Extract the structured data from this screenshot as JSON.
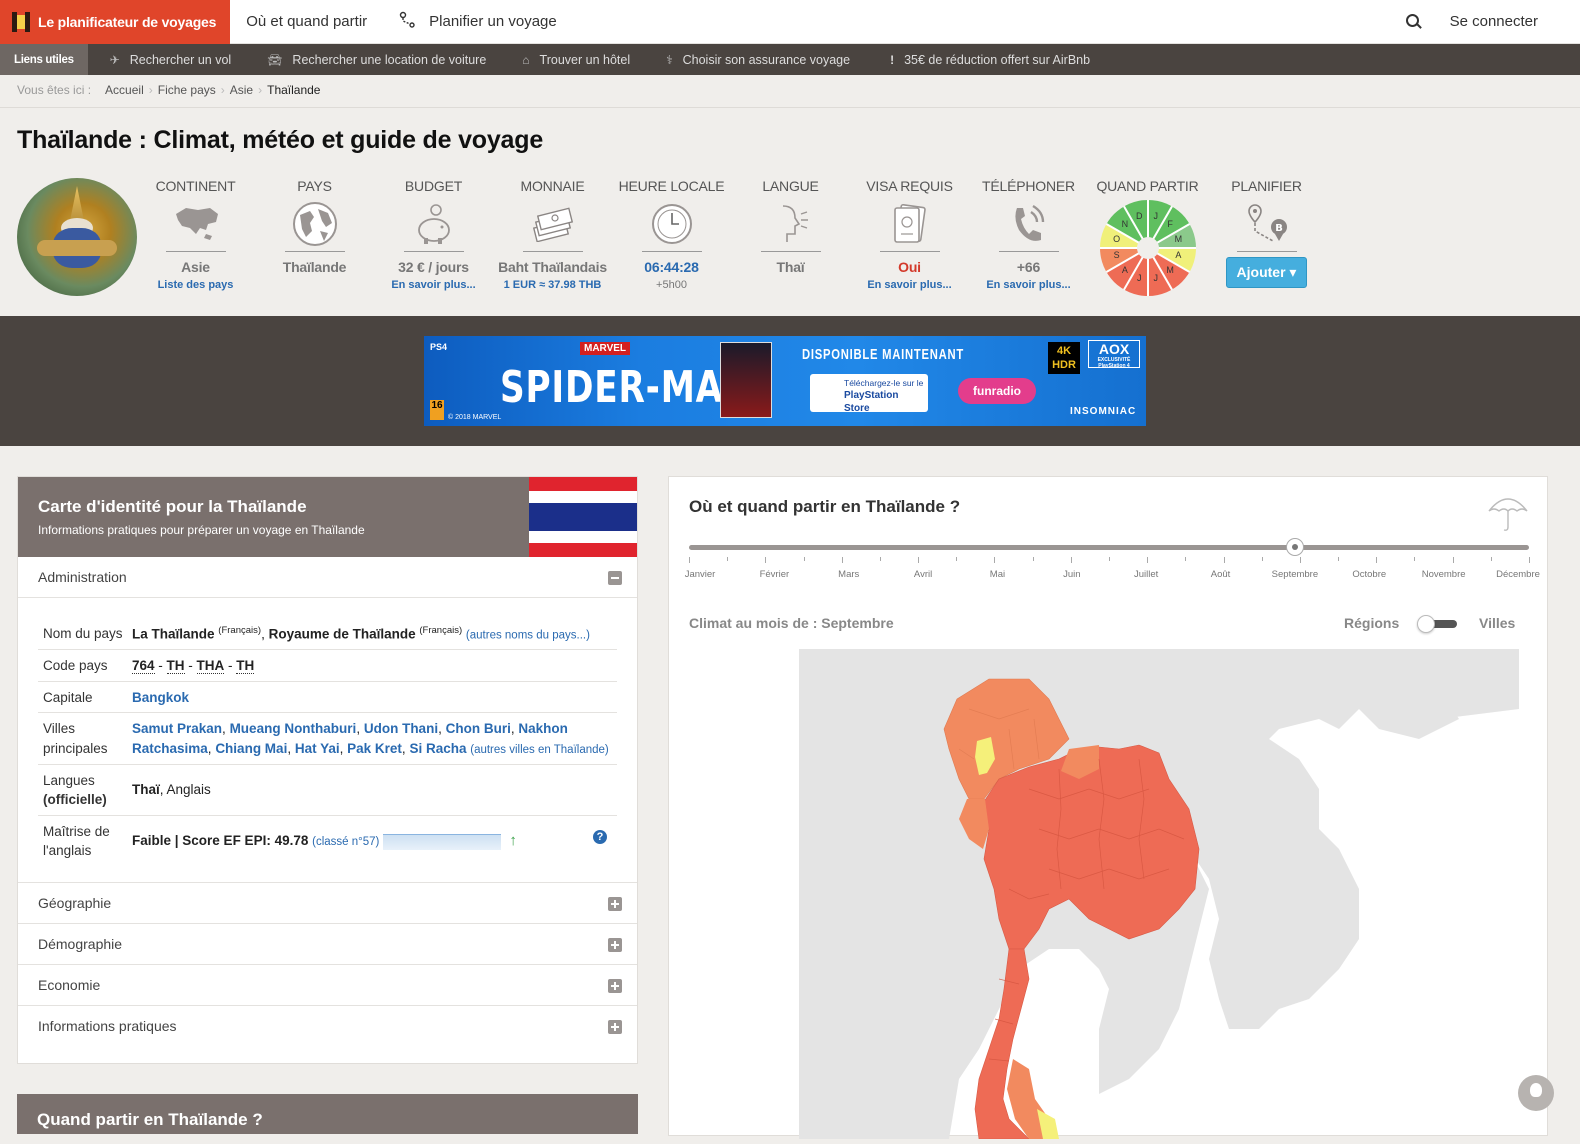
{
  "nav": {
    "brand": "Le planificateur de voyages",
    "where_when": "Où et quand partir",
    "plan_trip": "Planifier un voyage",
    "login": "Se connecter"
  },
  "links": {
    "label": "Liens utiles",
    "items": [
      {
        "icon": "plane-icon",
        "label": "Rechercher un vol"
      },
      {
        "icon": "car-icon",
        "label": "Rechercher une location de voiture"
      },
      {
        "icon": "bed-icon",
        "label": "Trouver un hôtel"
      },
      {
        "icon": "stethoscope-icon",
        "label": "Choisir son assurance voyage"
      },
      {
        "icon": "exclamation-icon",
        "label": "35€ de réduction offert sur AirBnb"
      }
    ]
  },
  "breadcrumb": {
    "prefix": "Vous êtes ici :",
    "items": [
      "Accueil",
      "Fiche pays",
      "Asie"
    ],
    "current": "Thaïlande"
  },
  "page_title": "Thaïlande : Climat, météo et guide de voyage",
  "facts": [
    {
      "head": "CONTINENT",
      "icon": "asia-map-icon",
      "value": "Asie",
      "sub": "Liste des pays"
    },
    {
      "head": "PAYS",
      "icon": "globe-icon",
      "value": "Thaïlande",
      "sub": ""
    },
    {
      "head": "BUDGET",
      "icon": "piggy-bank-icon",
      "value": "32 € / jours",
      "sub": "En savoir plus..."
    },
    {
      "head": "MONNAIE",
      "icon": "banknotes-icon",
      "value": "Baht Thaïlandais",
      "sub": "1 EUR ≈ 37.98 THB"
    },
    {
      "head": "HEURE LOCALE",
      "icon": "clock-icon",
      "value": "06:44:28",
      "sub": "+5h00"
    },
    {
      "head": "LANGUE",
      "icon": "speaking-head-icon",
      "value": "Thaï",
      "sub": ""
    },
    {
      "head": "VISA REQUIS",
      "icon": "passport-icon",
      "value": "Oui",
      "sub": "En savoir plus..."
    },
    {
      "head": "TÉLÉPHONER",
      "icon": "phone-icon",
      "value": "+66",
      "sub": "En savoir plus..."
    },
    {
      "head": "QUAND PARTIR",
      "icon": "month-wheel-icon"
    },
    {
      "head": "PLANIFIER",
      "icon": "route-pin-icon",
      "button": "Ajouter ▾"
    }
  ],
  "month_wheel": [
    "J",
    "F",
    "M",
    "A",
    "M",
    "J",
    "J",
    "A",
    "S",
    "O",
    "N",
    "D"
  ],
  "month_wheel_colors": [
    "#5fbf5f",
    "#5fbf5f",
    "#8bc98b",
    "#f0f07a",
    "#ee6b55",
    "#ee6b55",
    "#ee6b55",
    "#ee6b55",
    "#f28a5f",
    "#f0f07a",
    "#5fbf5f",
    "#5fbf5f"
  ],
  "ad": {
    "ps4": "PS4",
    "marvel": "MARVEL",
    "title": "SPIDER-MAN",
    "available": "DISPONIBLE MAINTENANT",
    "store_line1": "Téléchargez-le sur le",
    "store_line2": "PlayStation Store",
    "radio": "funradio",
    "hdr": "4K HDR",
    "aox": "AOX",
    "aox_sub": "EXCLUSIVITÉ PlayStation 4",
    "studio": "INSOMNIAC",
    "pegi": "16",
    "copyright": "© 2018 MARVEL"
  },
  "identity": {
    "title": "Carte d'identité pour la Thaïlande",
    "subtitle": "Informations pratiques pour préparer un voyage en Thaïlande",
    "flag_colors": [
      "#e0242e",
      "#ffffff",
      "#1b2f8a",
      "#ffffff",
      "#e0242e"
    ],
    "open_section": "Administration",
    "rows": {
      "name_key": "Nom du pays",
      "name_v1": "La Thaïlande",
      "name_lang1": "(Français)",
      "name_v2": "Royaume de Thaïlande",
      "name_lang2": "(Français)",
      "name_more": "(autres noms du pays...)",
      "code_key": "Code pays",
      "code_v1": "764",
      "code_v2": "TH",
      "code_v3": "THA",
      "code_v4": "TH",
      "capital_key": "Capitale",
      "capital": "Bangkok",
      "cities_key": "Villes principales",
      "cities": [
        "Samut Prakan",
        "Mueang Nonthaburi",
        "Udon Thani",
        "Chon Buri",
        "Nakhon Ratchasima",
        "Chiang Mai",
        "Hat Yai",
        "Pak Kret",
        "Si Racha"
      ],
      "cities_more": "(autres villes en Thaïlande)",
      "lang_key1": "Langues",
      "lang_key2": "(officielle)",
      "lang_v1": "Thaï",
      "lang_v2": ", Anglais",
      "eng_key": "Maîtrise de l'anglais",
      "eng_value": "Faible | Score EF EPI: 49.78",
      "eng_rank": "(classé n°57)",
      "eng_trend": "↑",
      "help": "?"
    },
    "sections": [
      "Géographie",
      "Démographie",
      "Economie",
      "Informations pratiques"
    ]
  },
  "next_card_title": "Quand partir en Thaïlande ?",
  "climate": {
    "title": "Où et quand partir en Thaïlande ?",
    "months": [
      "Janvier",
      "Février",
      "Mars",
      "Avril",
      "Mai",
      "Juin",
      "Juillet",
      "Août",
      "Septembre",
      "Octobre",
      "Novembre",
      "Décembre"
    ],
    "selected_month_index": 8,
    "month_label": "Climat au mois de : Septembre",
    "toggle_left": "Régions",
    "toggle_right": "Villes"
  }
}
